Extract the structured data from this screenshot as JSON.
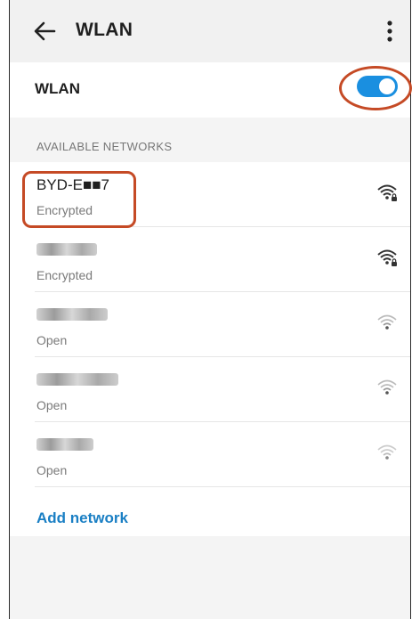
{
  "header": {
    "title": "WLAN",
    "back_icon": "arrow-left-icon",
    "more_icon": "more-vertical-icon"
  },
  "wlan_toggle": {
    "label": "WLAN",
    "state": "on",
    "accent": "#1a8fe0"
  },
  "available": {
    "header": "AVAILABLE NETWORKS",
    "networks": [
      {
        "name": "BYD-E■■7",
        "status": "Encrypted",
        "signal": "strong",
        "secure": true
      },
      {
        "name": "",
        "status": "Encrypted",
        "signal": "strong",
        "secure": true
      },
      {
        "name": "",
        "status": "Open",
        "signal": "weak",
        "secure": false
      },
      {
        "name": "",
        "status": "Open",
        "signal": "weak",
        "secure": false
      },
      {
        "name": "",
        "status": "Open",
        "signal": "weak",
        "secure": false
      }
    ]
  },
  "add_network": "Add network",
  "highlight_color": "#c54a25"
}
